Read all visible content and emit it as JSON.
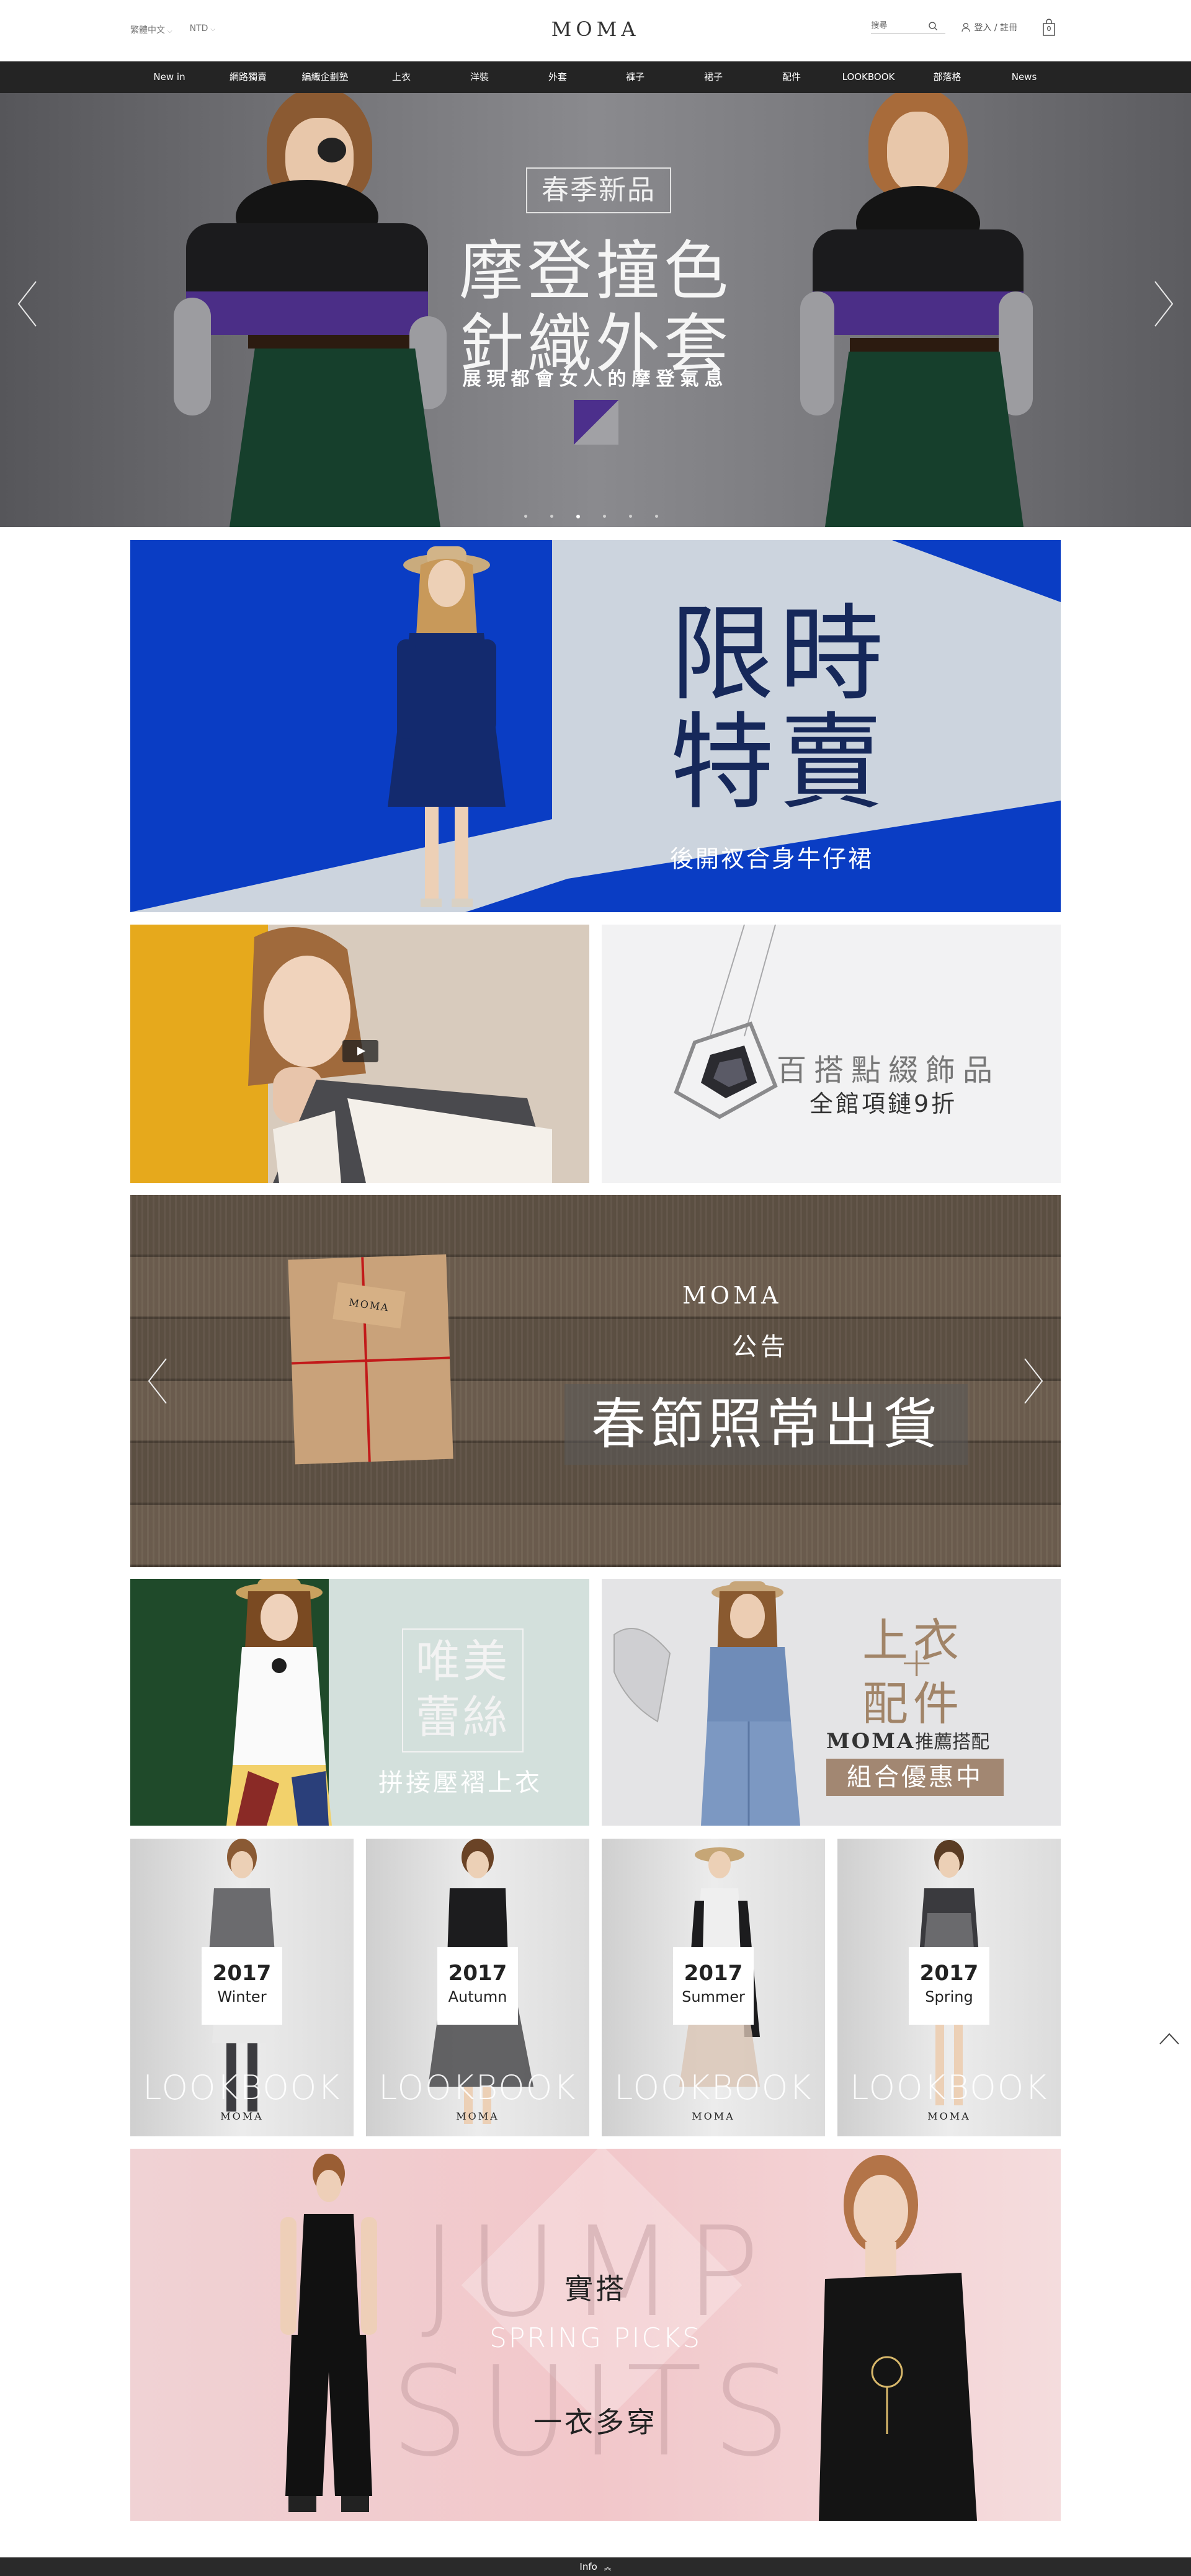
{
  "header": {
    "language": "繁體中文",
    "currency": "NTD",
    "logo": "MOMA",
    "search_placeholder": "搜尋",
    "account": "登入 / 註冊",
    "cart_count": "0"
  },
  "nav": {
    "items": [
      "New in",
      "網路獨賣",
      "編織企劃塾",
      "上衣",
      "洋裝",
      "外套",
      "褲子",
      "裙子",
      "配件",
      "LOOKBOOK",
      "部落格",
      "News"
    ]
  },
  "hero": {
    "tag": "春季新品",
    "title_line1": "摩登撞色",
    "title_line2": "針織外套",
    "subtitle": "展現都會女人的摩登氣息",
    "slide_count": 6,
    "active_slide": 3
  },
  "sale_banner": {
    "title_line1": "限時",
    "title_line2": "特賣",
    "subtitle": "後開衩合身牛仔裙"
  },
  "jewelry_banner": {
    "title": "百搭點綴飾品",
    "subtitle": "全館項鏈9折"
  },
  "notice_banner": {
    "brand": "MOMA",
    "tag": "公告",
    "message": "春節照常出貨",
    "parcel_tag": "MOMA"
  },
  "lace_banner": {
    "title_line1": "唯美",
    "title_line2": "蕾絲",
    "subtitle": "拼接壓褶上衣"
  },
  "combo_banner": {
    "title_line1": "上衣",
    "plus": "+",
    "title_line2": "配件",
    "brand": "MOMA",
    "recommend": "推薦搭配",
    "badge": "組合優惠中"
  },
  "lookbook": [
    {
      "year": "2017",
      "season": "Winter",
      "label": "LOOKBOOK",
      "brand": "MOMA"
    },
    {
      "year": "2017",
      "season": "Autumn",
      "label": "LOOKBOOK",
      "brand": "MOMA"
    },
    {
      "year": "2017",
      "season": "Summer",
      "label": "LOOKBOOK",
      "brand": "MOMA"
    },
    {
      "year": "2017",
      "season": "Spring",
      "label": "LOOKBOOK",
      "brand": "MOMA"
    }
  ],
  "jumpsuit_banner": {
    "big_line1": "JUMP",
    "big_line2": "SUITS",
    "title": "實搭",
    "subtitle": "SPRING PICKS",
    "tagline": "一衣多穿"
  },
  "footer": {
    "label": "Info"
  },
  "colors": {
    "nav_bg": "#242424",
    "sale_blue": "#0a3dc4",
    "sale_text": "#16285a",
    "combo_accent": "#a28772",
    "lace_green": "#1f4a2a"
  }
}
